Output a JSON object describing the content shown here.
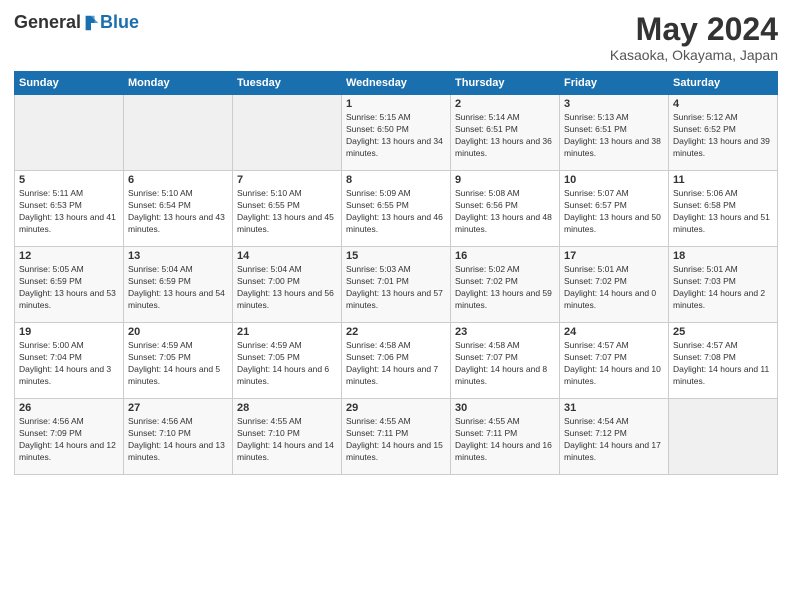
{
  "logo": {
    "general": "General",
    "blue": "Blue"
  },
  "header": {
    "month_year": "May 2024",
    "location": "Kasaoka, Okayama, Japan"
  },
  "days_of_week": [
    "Sunday",
    "Monday",
    "Tuesday",
    "Wednesday",
    "Thursday",
    "Friday",
    "Saturday"
  ],
  "weeks": [
    [
      {
        "day": "",
        "sunrise": "",
        "sunset": "",
        "daylight": "",
        "empty": true
      },
      {
        "day": "",
        "sunrise": "",
        "sunset": "",
        "daylight": "",
        "empty": true
      },
      {
        "day": "",
        "sunrise": "",
        "sunset": "",
        "daylight": "",
        "empty": true
      },
      {
        "day": "1",
        "sunrise": "Sunrise: 5:15 AM",
        "sunset": "Sunset: 6:50 PM",
        "daylight": "Daylight: 13 hours and 34 minutes."
      },
      {
        "day": "2",
        "sunrise": "Sunrise: 5:14 AM",
        "sunset": "Sunset: 6:51 PM",
        "daylight": "Daylight: 13 hours and 36 minutes."
      },
      {
        "day": "3",
        "sunrise": "Sunrise: 5:13 AM",
        "sunset": "Sunset: 6:51 PM",
        "daylight": "Daylight: 13 hours and 38 minutes."
      },
      {
        "day": "4",
        "sunrise": "Sunrise: 5:12 AM",
        "sunset": "Sunset: 6:52 PM",
        "daylight": "Daylight: 13 hours and 39 minutes."
      }
    ],
    [
      {
        "day": "5",
        "sunrise": "Sunrise: 5:11 AM",
        "sunset": "Sunset: 6:53 PM",
        "daylight": "Daylight: 13 hours and 41 minutes."
      },
      {
        "day": "6",
        "sunrise": "Sunrise: 5:10 AM",
        "sunset": "Sunset: 6:54 PM",
        "daylight": "Daylight: 13 hours and 43 minutes."
      },
      {
        "day": "7",
        "sunrise": "Sunrise: 5:10 AM",
        "sunset": "Sunset: 6:55 PM",
        "daylight": "Daylight: 13 hours and 45 minutes."
      },
      {
        "day": "8",
        "sunrise": "Sunrise: 5:09 AM",
        "sunset": "Sunset: 6:55 PM",
        "daylight": "Daylight: 13 hours and 46 minutes."
      },
      {
        "day": "9",
        "sunrise": "Sunrise: 5:08 AM",
        "sunset": "Sunset: 6:56 PM",
        "daylight": "Daylight: 13 hours and 48 minutes."
      },
      {
        "day": "10",
        "sunrise": "Sunrise: 5:07 AM",
        "sunset": "Sunset: 6:57 PM",
        "daylight": "Daylight: 13 hours and 50 minutes."
      },
      {
        "day": "11",
        "sunrise": "Sunrise: 5:06 AM",
        "sunset": "Sunset: 6:58 PM",
        "daylight": "Daylight: 13 hours and 51 minutes."
      }
    ],
    [
      {
        "day": "12",
        "sunrise": "Sunrise: 5:05 AM",
        "sunset": "Sunset: 6:59 PM",
        "daylight": "Daylight: 13 hours and 53 minutes."
      },
      {
        "day": "13",
        "sunrise": "Sunrise: 5:04 AM",
        "sunset": "Sunset: 6:59 PM",
        "daylight": "Daylight: 13 hours and 54 minutes."
      },
      {
        "day": "14",
        "sunrise": "Sunrise: 5:04 AM",
        "sunset": "Sunset: 7:00 PM",
        "daylight": "Daylight: 13 hours and 56 minutes."
      },
      {
        "day": "15",
        "sunrise": "Sunrise: 5:03 AM",
        "sunset": "Sunset: 7:01 PM",
        "daylight": "Daylight: 13 hours and 57 minutes."
      },
      {
        "day": "16",
        "sunrise": "Sunrise: 5:02 AM",
        "sunset": "Sunset: 7:02 PM",
        "daylight": "Daylight: 13 hours and 59 minutes."
      },
      {
        "day": "17",
        "sunrise": "Sunrise: 5:01 AM",
        "sunset": "Sunset: 7:02 PM",
        "daylight": "Daylight: 14 hours and 0 minutes."
      },
      {
        "day": "18",
        "sunrise": "Sunrise: 5:01 AM",
        "sunset": "Sunset: 7:03 PM",
        "daylight": "Daylight: 14 hours and 2 minutes."
      }
    ],
    [
      {
        "day": "19",
        "sunrise": "Sunrise: 5:00 AM",
        "sunset": "Sunset: 7:04 PM",
        "daylight": "Daylight: 14 hours and 3 minutes."
      },
      {
        "day": "20",
        "sunrise": "Sunrise: 4:59 AM",
        "sunset": "Sunset: 7:05 PM",
        "daylight": "Daylight: 14 hours and 5 minutes."
      },
      {
        "day": "21",
        "sunrise": "Sunrise: 4:59 AM",
        "sunset": "Sunset: 7:05 PM",
        "daylight": "Daylight: 14 hours and 6 minutes."
      },
      {
        "day": "22",
        "sunrise": "Sunrise: 4:58 AM",
        "sunset": "Sunset: 7:06 PM",
        "daylight": "Daylight: 14 hours and 7 minutes."
      },
      {
        "day": "23",
        "sunrise": "Sunrise: 4:58 AM",
        "sunset": "Sunset: 7:07 PM",
        "daylight": "Daylight: 14 hours and 8 minutes."
      },
      {
        "day": "24",
        "sunrise": "Sunrise: 4:57 AM",
        "sunset": "Sunset: 7:07 PM",
        "daylight": "Daylight: 14 hours and 10 minutes."
      },
      {
        "day": "25",
        "sunrise": "Sunrise: 4:57 AM",
        "sunset": "Sunset: 7:08 PM",
        "daylight": "Daylight: 14 hours and 11 minutes."
      }
    ],
    [
      {
        "day": "26",
        "sunrise": "Sunrise: 4:56 AM",
        "sunset": "Sunset: 7:09 PM",
        "daylight": "Daylight: 14 hours and 12 minutes."
      },
      {
        "day": "27",
        "sunrise": "Sunrise: 4:56 AM",
        "sunset": "Sunset: 7:10 PM",
        "daylight": "Daylight: 14 hours and 13 minutes."
      },
      {
        "day": "28",
        "sunrise": "Sunrise: 4:55 AM",
        "sunset": "Sunset: 7:10 PM",
        "daylight": "Daylight: 14 hours and 14 minutes."
      },
      {
        "day": "29",
        "sunrise": "Sunrise: 4:55 AM",
        "sunset": "Sunset: 7:11 PM",
        "daylight": "Daylight: 14 hours and 15 minutes."
      },
      {
        "day": "30",
        "sunrise": "Sunrise: 4:55 AM",
        "sunset": "Sunset: 7:11 PM",
        "daylight": "Daylight: 14 hours and 16 minutes."
      },
      {
        "day": "31",
        "sunrise": "Sunrise: 4:54 AM",
        "sunset": "Sunset: 7:12 PM",
        "daylight": "Daylight: 14 hours and 17 minutes."
      },
      {
        "day": "",
        "sunrise": "",
        "sunset": "",
        "daylight": "",
        "empty": true
      }
    ]
  ]
}
